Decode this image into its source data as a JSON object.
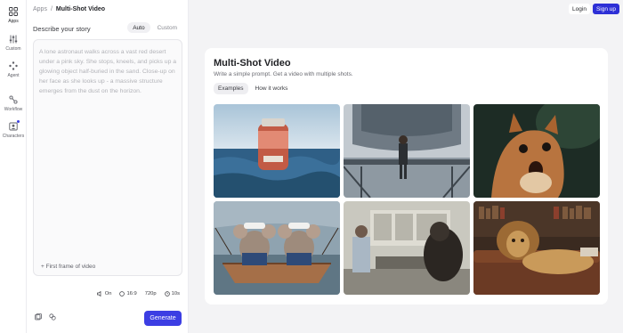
{
  "rail": {
    "items": [
      {
        "label": "Apps",
        "icon": "apps-icon"
      },
      {
        "label": "Custom",
        "icon": "sliders-icon"
      },
      {
        "label": "Agent",
        "icon": "agent-icon"
      },
      {
        "label": "Workflow",
        "icon": "workflow-icon"
      },
      {
        "label": "Characters",
        "icon": "characters-icon"
      }
    ]
  },
  "breadcrumb": {
    "root": "Apps",
    "sep": "/",
    "current": "Multi-Shot Video"
  },
  "story": {
    "label": "Describe your story",
    "modes": [
      "Auto",
      "Custom"
    ],
    "prompt": "A lone astronaut walks across a vast red desert under a pink sky. She stops, kneels, and picks up a glowing object half-buried in the sand. Close-up on her face as she looks up - a massive structure emerges from the dust on the horizon.",
    "first_frame": "+ First frame of video"
  },
  "options": {
    "audio": "On",
    "ratio": "16:9",
    "resolution": "720p",
    "duration": "10s"
  },
  "generate": "Generate",
  "auth": {
    "login": "Login",
    "signup": "Sign up"
  },
  "card": {
    "title": "Multi-Shot Video",
    "subtitle": "Write a simple prompt. Get a video with multiple shots.",
    "tabs": [
      "Examples",
      "How it works"
    ]
  },
  "colors": {
    "accent": "#3c3ee3"
  }
}
